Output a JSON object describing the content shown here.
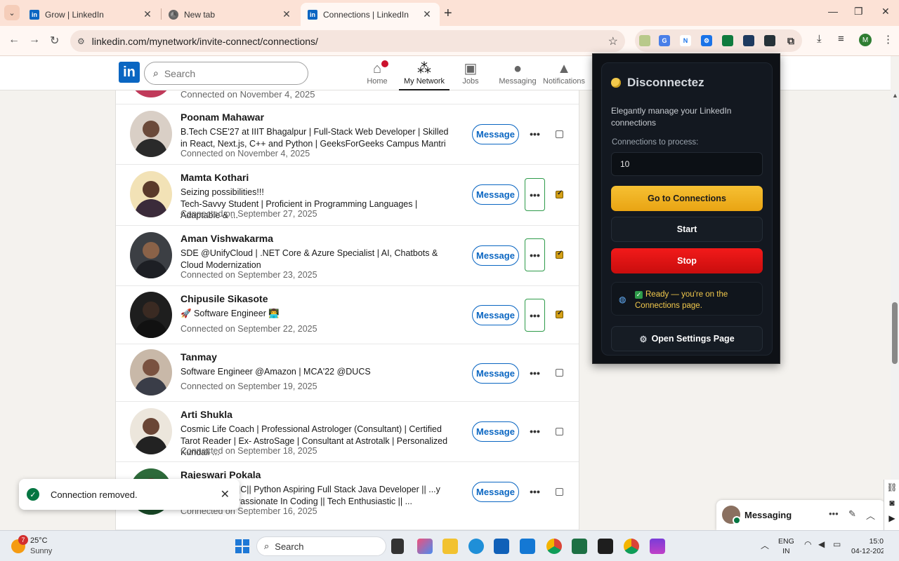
{
  "browser": {
    "tabs": [
      {
        "title": "Grow | LinkedIn",
        "active": false
      },
      {
        "title": "New tab",
        "active": false
      },
      {
        "title": "Connections | LinkedIn",
        "active": true
      }
    ],
    "url": "linkedin.com/mynetwork/invite-connect/connections/",
    "profile_initial": "M"
  },
  "linkedin": {
    "logo_text": "in",
    "search_placeholder": "Search",
    "nav": [
      {
        "label": "Home",
        "icon": "home-icon"
      },
      {
        "label": "My Network",
        "icon": "my-network-icon",
        "active": true
      },
      {
        "label": "Jobs",
        "icon": "jobs-icon"
      },
      {
        "label": "Messaging",
        "icon": "messaging-icon"
      },
      {
        "label": "Notifications",
        "icon": "notifications-icon"
      }
    ],
    "top_partial_row": {
      "connected": "Connected on November 4, 2025"
    },
    "message_label": "Message",
    "more_label": "•••",
    "connections": [
      {
        "name": "Poonam Mahawar",
        "headline": "B.Tech CSE'27 at IIIT Bhagalpur | Full-Stack Web Developer | Skilled in React, Next.js, C++ and Python | GeeksForGeeks Campus Mantri",
        "connected": "Connected on November 4, 2025",
        "checked": false,
        "highlighted": false
      },
      {
        "name": "Mamta Kothari",
        "headline": "Seizing possibilities!!!\nTech-Savvy Student | Proficient in Programming Languages | Adaptable & ...",
        "connected": "Connected on September 27, 2025",
        "checked": true,
        "highlighted": true
      },
      {
        "name": "Aman Vishwakarma",
        "headline": "SDE @UnifyCloud | .NET Core & Azure Specialist | AI, Chatbots & Cloud Modernization",
        "connected": "Connected on September 23, 2025",
        "checked": true,
        "highlighted": true
      },
      {
        "name": "Chipusile Sikasote",
        "headline": "🚀 Software Engineer 👨‍💻",
        "connected": "Connected on September 22, 2025",
        "checked": true,
        "highlighted": true
      },
      {
        "name": "Tanmay",
        "headline": "Software Engineer @Amazon | MCA'22 @DUCS",
        "connected": "Connected on September 19, 2025",
        "checked": false,
        "highlighted": false
      },
      {
        "name": "Arti Shukla",
        "headline": "Cosmic Life Coach | Professional Astrologer (Consultant) | Certified Tarot Reader | Ex- AstroSage | Consultant at Astrotalk | Personalized Kundali ...",
        "connected": "Connected on September 18, 2025",
        "checked": false,
        "highlighted": false
      },
      {
        "name": "Rajeswari Pokala",
        "headline": "...oper || Java ||C|| Python Aspiring Full Stack Java Developer || ...y @Microsoft || Passionate In Coding || Tech Enthusiastic || ...",
        "connected": "Connected on September 16, 2025",
        "checked": false,
        "highlighted": false
      }
    ],
    "toast": {
      "text": "Connection removed.",
      "close": "✕"
    },
    "messaging_dock": {
      "title": "Messaging"
    }
  },
  "extension": {
    "title": "Disconnectez",
    "subtitle": "Elegantly manage your LinkedIn connections",
    "count_label": "Connections to process:",
    "count_value": "10",
    "buttons": {
      "go": "Go to Connections",
      "start": "Start",
      "stop": "Stop",
      "settings": "Open Settings Page"
    },
    "status": "Ready — you're on the Connections page."
  },
  "taskbar": {
    "weather_badge": "7",
    "temperature": "25°C",
    "condition": "Sunny",
    "search_label": "Search",
    "lang_1": "ENG",
    "lang_2": "IN",
    "time": "15:0",
    "date": "04-12-202"
  },
  "colors": {
    "linkedin_blue": "#0a66c2",
    "tab_bar": "#fce2d6",
    "extension_gold": "#f6c033",
    "extension_red": "#f21a1a",
    "highlight_green": "#2e9b4a"
  }
}
